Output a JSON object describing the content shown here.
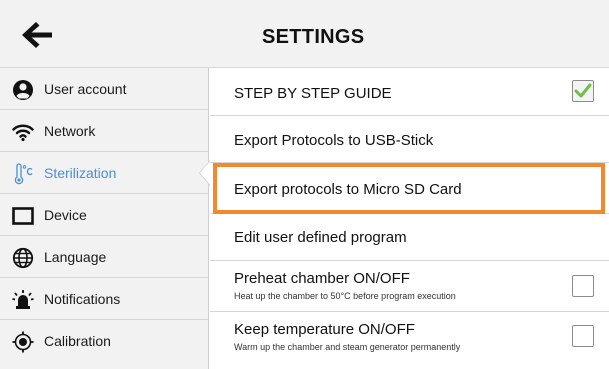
{
  "header": {
    "title": "SETTINGS",
    "back_icon": "arrow-left-icon"
  },
  "sidebar": {
    "items": [
      {
        "label": "User account",
        "icon": "user-circle-icon"
      },
      {
        "label": "Network",
        "icon": "wifi-icon"
      },
      {
        "label": "Sterilization",
        "icon": "thermometer-celsius-icon",
        "active": true
      },
      {
        "label": "Device",
        "icon": "device-square-icon"
      },
      {
        "label": "Language",
        "icon": "globe-icon"
      },
      {
        "label": "Notifications",
        "icon": "alarm-light-icon"
      },
      {
        "label": "Calibration",
        "icon": "target-icon"
      }
    ],
    "active_color": "#4a8fd6"
  },
  "settings": {
    "step_by_step": {
      "label": "STEP BY STEP GUIDE",
      "checked": true
    },
    "export_usb": {
      "label": "Export Protocols to USB-Stick"
    },
    "export_sd": {
      "label": "Export protocols to Micro SD Card",
      "highlighted": true
    },
    "edit_program": {
      "label": "Edit user defined program"
    },
    "preheat": {
      "label": "Preheat chamber ON/OFF",
      "sublabel": "Heat up the chamber to 50°C before program execution",
      "checked": false
    },
    "keep_temp": {
      "label": "Keep temperature ON/OFF",
      "sublabel": "Warm up the chamber and steam generator permanently",
      "checked": false
    }
  },
  "colors": {
    "highlight": "#f08a2c",
    "check_green": "#6cc04a"
  }
}
